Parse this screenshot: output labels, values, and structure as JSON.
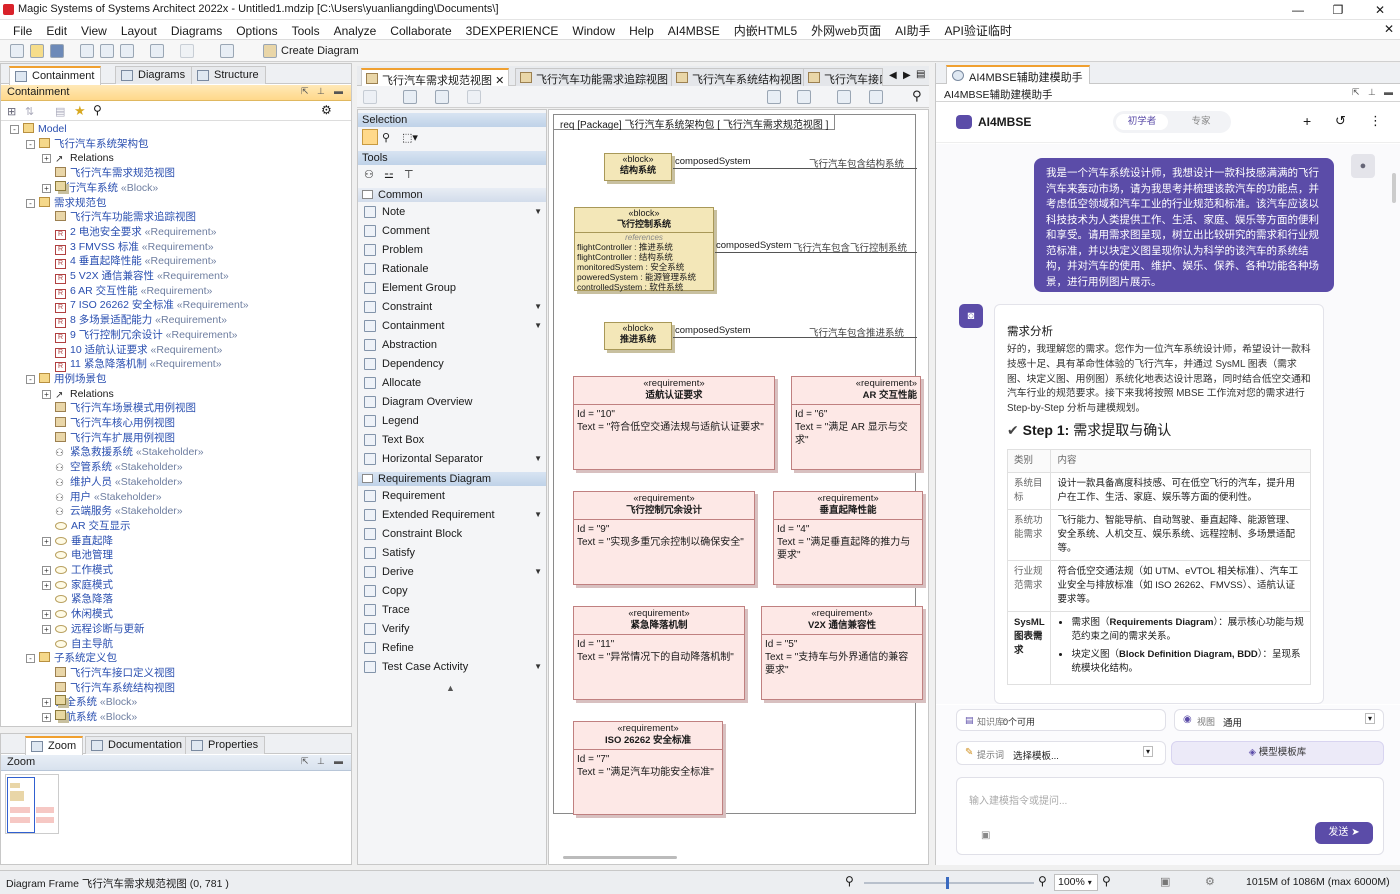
{
  "window": {
    "title": "Magic Systems of Systems Architect 2022x - Untitled1.mdzip [C:\\Users\\yuanliangding\\Documents\\]"
  },
  "menu": [
    "File",
    "Edit",
    "View",
    "Layout",
    "Diagrams",
    "Options",
    "Tools",
    "Analyze",
    "Collaborate",
    "3DEXPERIENCE",
    "Window",
    "Help",
    "AI4MBSE",
    "内嵌HTML5",
    "外网web页面",
    "AI助手",
    "API验证临时"
  ],
  "toolbar": {
    "create_diagram": "Create Diagram"
  },
  "left_tabs": [
    "Containment",
    "Diagrams",
    "Structure"
  ],
  "containment_header": "Containment",
  "tree": [
    {
      "t": "Model",
      "lvl": 0,
      "ic": "pkg",
      "exp": "-"
    },
    {
      "t": "飞行汽车系统架构包",
      "lvl": 1,
      "ic": "pkg",
      "exp": "-"
    },
    {
      "t": "Relations",
      "lvl": 2,
      "ic": "rel",
      "exp": "+",
      "plain": true
    },
    {
      "t": "飞行汽车需求规范视图",
      "lvl": 2,
      "ic": "diag"
    },
    {
      "t": "飞行汽车系统",
      "st": " «Block»",
      "lvl": 2,
      "ic": "blk",
      "exp": "+"
    },
    {
      "t": "需求规范包",
      "lvl": 1,
      "ic": "pkg",
      "exp": "-"
    },
    {
      "t": "飞行汽车功能需求追踪视图",
      "lvl": 2,
      "ic": "diag"
    },
    {
      "t": "2 电池安全要求",
      "st": " «Requirement»",
      "lvl": 2,
      "ic": "req"
    },
    {
      "t": "3 FMVSS 标准",
      "st": " «Requirement»",
      "lvl": 2,
      "ic": "req"
    },
    {
      "t": "4 垂直起降性能",
      "st": " «Requirement»",
      "lvl": 2,
      "ic": "req"
    },
    {
      "t": "5 V2X 通信兼容性",
      "st": " «Requirement»",
      "lvl": 2,
      "ic": "req"
    },
    {
      "t": "6 AR 交互性能",
      "st": " «Requirement»",
      "lvl": 2,
      "ic": "req"
    },
    {
      "t": "7 ISO 26262 安全标准",
      "st": " «Requirement»",
      "lvl": 2,
      "ic": "req"
    },
    {
      "t": "8 多场景适配能力",
      "st": " «Requirement»",
      "lvl": 2,
      "ic": "req"
    },
    {
      "t": "9 飞行控制冗余设计",
      "st": " «Requirement»",
      "lvl": 2,
      "ic": "req"
    },
    {
      "t": "10 适航认证要求",
      "st": " «Requirement»",
      "lvl": 2,
      "ic": "req"
    },
    {
      "t": "11 紧急降落机制",
      "st": " «Requirement»",
      "lvl": 2,
      "ic": "req"
    },
    {
      "t": "用例场景包",
      "lvl": 1,
      "ic": "pkg",
      "exp": "-"
    },
    {
      "t": "Relations",
      "lvl": 2,
      "ic": "rel",
      "exp": "+",
      "plain": true
    },
    {
      "t": "飞行汽车场景模式用例视图",
      "lvl": 2,
      "ic": "diag"
    },
    {
      "t": "飞行汽车核心用例视图",
      "lvl": 2,
      "ic": "diag"
    },
    {
      "t": "飞行汽车扩展用例视图",
      "lvl": 2,
      "ic": "diag"
    },
    {
      "t": "紧急救援系统",
      "st": " «Stakeholder»",
      "lvl": 2,
      "ic": "stk"
    },
    {
      "t": "空管系统",
      "st": " «Stakeholder»",
      "lvl": 2,
      "ic": "stk"
    },
    {
      "t": "维护人员",
      "st": " «Stakeholder»",
      "lvl": 2,
      "ic": "stk"
    },
    {
      "t": "用户",
      "st": " «Stakeholder»",
      "lvl": 2,
      "ic": "stk"
    },
    {
      "t": "云端服务",
      "st": " «Stakeholder»",
      "lvl": 2,
      "ic": "stk"
    },
    {
      "t": "AR 交互显示",
      "lvl": 2,
      "ic": "uc"
    },
    {
      "t": "垂直起降",
      "lvl": 2,
      "ic": "uc",
      "exp": "+"
    },
    {
      "t": "电池管理",
      "lvl": 2,
      "ic": "uc"
    },
    {
      "t": "工作模式",
      "lvl": 2,
      "ic": "uc",
      "exp": "+"
    },
    {
      "t": "家庭模式",
      "lvl": 2,
      "ic": "uc",
      "exp": "+"
    },
    {
      "t": "紧急降落",
      "lvl": 2,
      "ic": "uc"
    },
    {
      "t": "休闲模式",
      "lvl": 2,
      "ic": "uc",
      "exp": "+"
    },
    {
      "t": "远程诊断与更新",
      "lvl": 2,
      "ic": "uc",
      "exp": "+"
    },
    {
      "t": "自主导航",
      "lvl": 2,
      "ic": "uc"
    },
    {
      "t": "子系统定义包",
      "lvl": 1,
      "ic": "pkg",
      "exp": "-"
    },
    {
      "t": "飞行汽车接口定义视图",
      "lvl": 2,
      "ic": "diag"
    },
    {
      "t": "飞行汽车系统结构视图",
      "lvl": 2,
      "ic": "diag"
    },
    {
      "t": "安全系统",
      "st": " «Block»",
      "lvl": 2,
      "ic": "blk",
      "exp": "+"
    },
    {
      "t": "导航系统",
      "st": " «Block»",
      "lvl": 2,
      "ic": "blk",
      "exp": "+"
    }
  ],
  "bottom_tabs": [
    "Zoom",
    "Documentation",
    "Properties"
  ],
  "zoom_header": "Zoom",
  "diagram_tabs": [
    "飞行汽车需求规范视图",
    "飞行汽车功能需求追踪视图",
    "飞行汽车系统结构视图",
    "飞行汽车接口"
  ],
  "palette": {
    "selection": "Selection",
    "tools": "Tools",
    "common": "Common",
    "common_items": [
      {
        "t": "Note",
        "dd": true
      },
      {
        "t": "Comment"
      },
      {
        "t": "Problem"
      },
      {
        "t": "Rationale"
      },
      {
        "t": "Element Group"
      },
      {
        "t": "Constraint",
        "dd": true
      },
      {
        "t": "Containment",
        "dd": true
      },
      {
        "t": "Abstraction"
      },
      {
        "t": "Dependency"
      },
      {
        "t": "Allocate"
      },
      {
        "t": "Diagram Overview"
      },
      {
        "t": "Legend"
      },
      {
        "t": "Text Box"
      },
      {
        "t": "Horizontal Separator",
        "dd": true
      }
    ],
    "req_diagram": "Requirements Diagram",
    "req_items": [
      {
        "t": "Requirement"
      },
      {
        "t": "Extended Requirement",
        "dd": true
      },
      {
        "t": "Constraint Block"
      },
      {
        "t": "Satisfy"
      },
      {
        "t": "Derive",
        "dd": true
      },
      {
        "t": "Copy"
      },
      {
        "t": "Trace"
      },
      {
        "t": "Verify"
      },
      {
        "t": "Refine"
      },
      {
        "t": "Test Case Activity",
        "dd": true
      }
    ]
  },
  "diagram": {
    "frame_label": "req [Package] 飞行汽车系统架构包 [ 飞行汽车需求规范视图 ]",
    "block_stereo": "«block»",
    "blocks": {
      "b1": "结构系统",
      "b2": "飞行控制系统",
      "b3": "推进系统"
    },
    "b2_refs_title": "references",
    "b2_refs": [
      "flightController : 推进系统",
      "flightController : 结构系统",
      "monitoredSystem : 安全系统",
      "poweredSystem : 能源管理系统",
      "controlledSystem : 软件系统"
    ],
    "composed": "composedSystem",
    "conn_labels": {
      "c1": "飞行汽车包含结构系统",
      "c2": "飞行汽车包含飞行控制系统",
      "c3": "飞行汽车包含推进系统"
    },
    "req_stereo": "«requirement»",
    "reqs": {
      "r10": {
        "name": "适航认证要求",
        "id": "Id = \"10\"",
        "text": "Text = \"符合低空交通法规与适航认证要求\""
      },
      "r6": {
        "name": "AR 交互性能",
        "id": "Id = \"6\"",
        "text": "Text = \"满足 AR 显示与交",
        "text2": "求\""
      },
      "r9": {
        "name": "飞行控制冗余设计",
        "id": "Id = \"9\"",
        "text": "Text = \"实现多重冗余控制以确保安全\""
      },
      "r4": {
        "name": "垂直起降性能",
        "id": "Id = \"4\"",
        "text": "Text = \"满足垂直起降的推力与",
        "text2": "要求\""
      },
      "r11": {
        "name": "紧急降落机制",
        "id": "Id = \"11\"",
        "text": "Text = \"异常情况下的自动降落机制\""
      },
      "r5": {
        "name": "V2X 通信兼容性",
        "id": "Id = \"5\"",
        "text": "Text = \"支持车与外界通信的兼容",
        "text2": "要求\""
      },
      "r7": {
        "name": "ISO 26262 安全标准",
        "id": "Id = \"7\"",
        "text": "Text = \"满足汽车功能安全标准\""
      }
    }
  },
  "ai": {
    "tab": "AI4MBSE辅助建模助手",
    "header": "AI4MBSE辅助建模助手",
    "brand": "AI4MBSE",
    "mode_beginner": "初学者",
    "mode_expert": "专家",
    "user_msg": "我是一个汽车系统设计师，我想设计一款科技感满满的飞行汽车来轰动市场，请为我思考并梳理该款汽车的功能点，并考虑低空领域和汽车工业的行业规范和标准。该汽车应该以科技技术为人类提供工作、生活、家庭、娱乐等方面的便利和享受。请用需求图呈现，树立出比较研究的需求和行业规范标准，并以块定义图呈现你认为科学的该汽车的系统结构，并对汽车的使用、维护、娱乐、保养、各种功能各种场景，进行用例图片展示。",
    "section_title": "需求分析",
    "reply_intro": "好的，我理解您的需求。您作为一位汽车系统设计师，希望设计一款科技感十足、具有革命性体验的飞行汽车，并通过 SysML 图表（需求图、块定义图、用例图）系统化地表达设计思路，同时结合低空交通和汽车行业的规范要求。接下来我将按照 MBSE 工作流对您的需求进行 Step-by-Step 分析与建模规划。",
    "step_label": "Step 1:",
    "step_title": " 需求提取与确认",
    "table_header": [
      "类别",
      "内容"
    ],
    "table_rows": [
      [
        "系统目标",
        "设计一款具备高度科技感、可在低空飞行的汽车，提升用户在工作、生活、家庭、娱乐等方面的便利性。"
      ],
      [
        "系统功能需求",
        "飞行能力、智能导航、自动驾驶、垂直起降、能源管理、安全系统、人机交互、娱乐系统、远程控制、多场景适配等。"
      ],
      [
        "行业规范需求",
        "符合低空交通法规（如 UTM、eVTOL 相关标准）、汽车工业安全与排放标准（如 ISO 26262、FMVSS）、适航认证要求等。"
      ],
      [
        "SysML 图表需求",
        ""
      ]
    ],
    "bullets": [
      {
        "pre": "需求图（",
        "b": "Requirements Diagram",
        "post": "）：展示核心功能与规范约束之间的需求关系。"
      },
      {
        "pre": "块定义图（",
        "b": "Block Definition Diagram, BDD",
        "post": "）：呈现系统模块化结构。"
      }
    ],
    "kb_label": "知识库:",
    "kb_value": "0个可用",
    "view_label": "视图",
    "view_value": "通用",
    "prompt_label": "提示词",
    "prompt_value": "选择模板...",
    "template_btn": "模型模板库",
    "input_placeholder": "输入建模指令或提问...",
    "send": "发送"
  },
  "status": {
    "left": "Diagram Frame 飞行汽车需求规范视图 (0, 781 )",
    "zoom": "100%",
    "memory": "1015M of 1086M (max 6000M)"
  },
  "colors": {
    "accent": "#5b4ca8",
    "req_fill": "#fde8e6",
    "block_fill": "#f3e7b8"
  }
}
